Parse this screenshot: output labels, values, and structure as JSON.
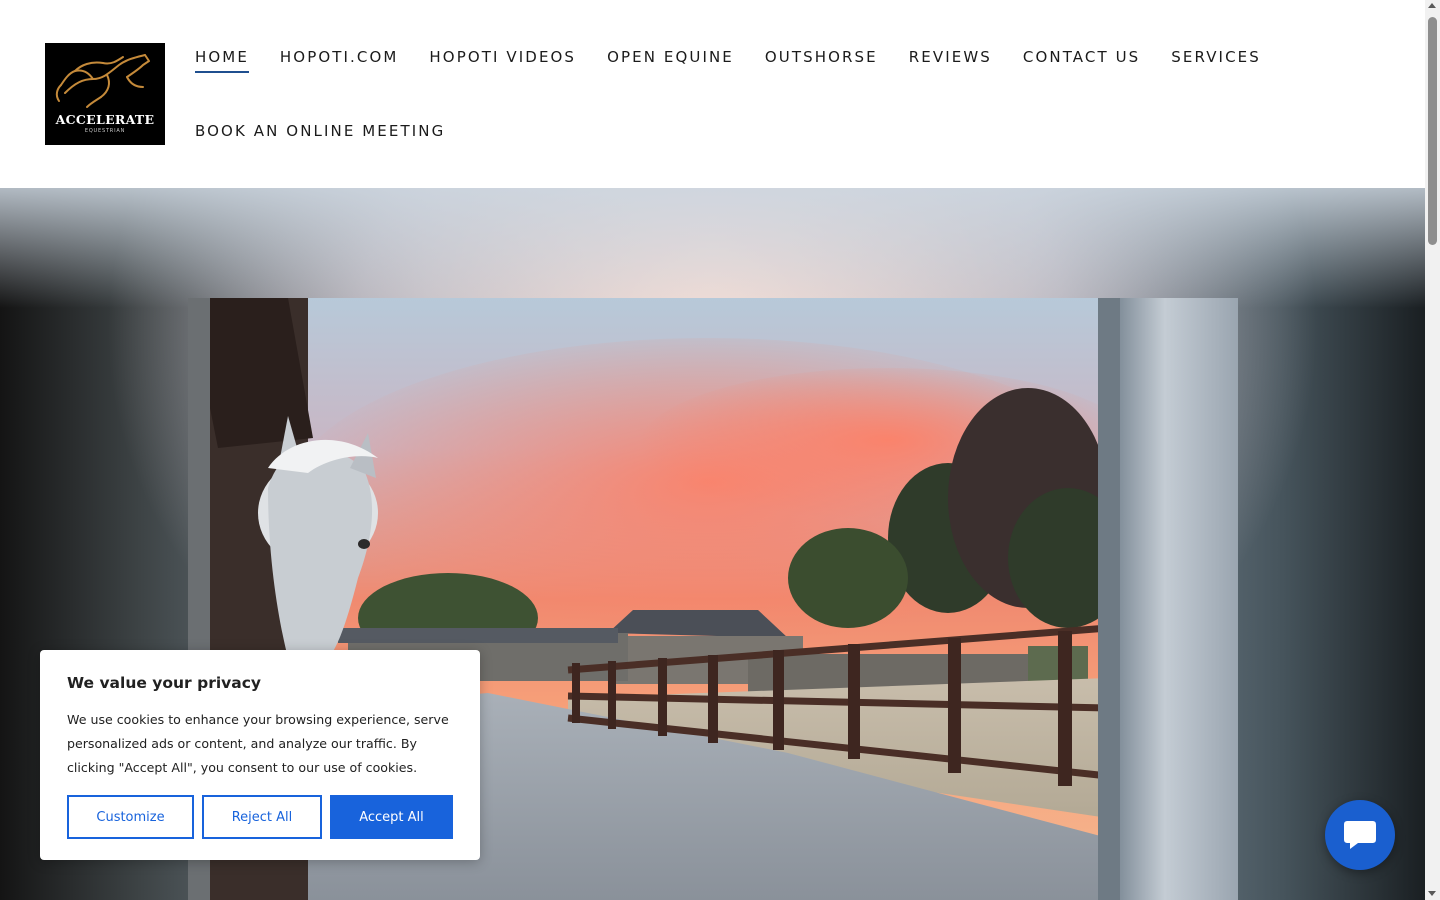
{
  "brand": {
    "name": "ACCELERATE",
    "tagline": "EQUESTRIAN",
    "logo_colors": {
      "background": "#000000",
      "horse": "#c58a3a"
    }
  },
  "nav": {
    "row1": [
      "HOME",
      "HOPOTI.COM",
      "HOPOTI VIDEOS",
      "OPEN EQUINE",
      "OUTSHORSE",
      "REVIEWS",
      "CONTACT US",
      "SERVICES"
    ],
    "row2": [
      "BOOK AN ONLINE MEETING"
    ],
    "active": "HOME",
    "active_color": "#1f4f8f"
  },
  "hero": {
    "image_description_icon": "stable-yard-sunset-photo"
  },
  "cookie": {
    "title": "We value your privacy",
    "body": "We use cookies to enhance your browsing experience, serve personalized ads or content, and analyze our traffic. By clicking \"Accept All\", you consent to our use of cookies.",
    "customize_label": "Customize",
    "reject_label": "Reject All",
    "accept_label": "Accept All",
    "accent_color": "#1863dc"
  },
  "chat": {
    "icon": "chat-bubble-icon",
    "color": "#1a5fcf"
  }
}
